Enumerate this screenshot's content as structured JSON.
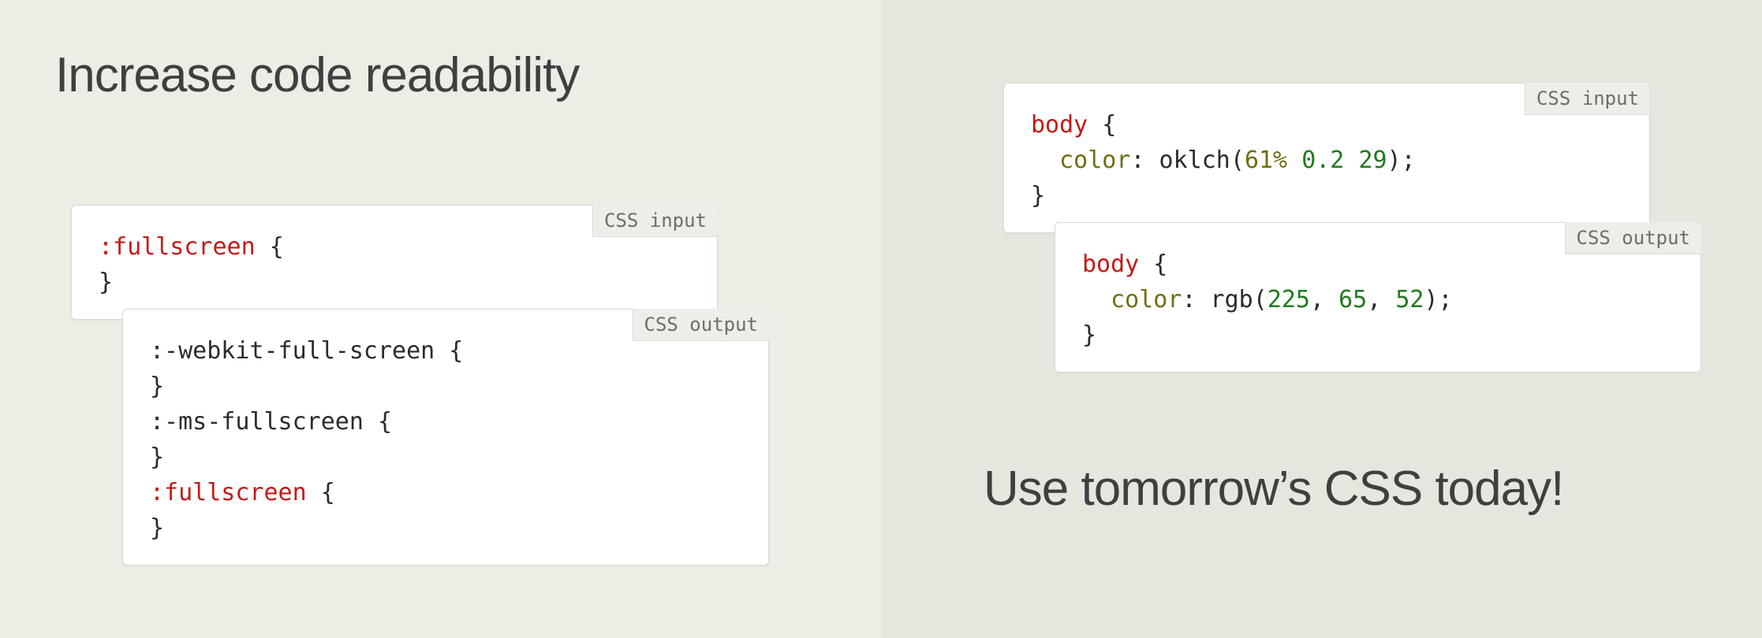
{
  "left": {
    "heading": "Increase code readability",
    "input": {
      "badge": "CSS input",
      "lines": [
        {
          "tokens": [
            {
              "cls": "sel",
              "text": ":fullscreen"
            },
            {
              "cls": null,
              "text": " {"
            }
          ]
        },
        {
          "tokens": [
            {
              "cls": null,
              "text": "}"
            }
          ]
        }
      ]
    },
    "output": {
      "badge": "CSS output",
      "lines": [
        {
          "tokens": [
            {
              "cls": null,
              "text": ":-webkit-full-screen {"
            }
          ]
        },
        {
          "tokens": [
            {
              "cls": null,
              "text": "}"
            }
          ]
        },
        {
          "tokens": [
            {
              "cls": null,
              "text": ":-ms-fullscreen {"
            }
          ]
        },
        {
          "tokens": [
            {
              "cls": null,
              "text": "}"
            }
          ]
        },
        {
          "tokens": [
            {
              "cls": "sel",
              "text": ":fullscreen"
            },
            {
              "cls": null,
              "text": " {"
            }
          ]
        },
        {
          "tokens": [
            {
              "cls": null,
              "text": "}"
            }
          ]
        }
      ]
    }
  },
  "right": {
    "heading": "Use tomorrow’s CSS today!",
    "input": {
      "badge": "CSS input",
      "lines": [
        {
          "tokens": [
            {
              "cls": "sel",
              "text": "body"
            },
            {
              "cls": null,
              "text": " {"
            }
          ]
        },
        {
          "tokens": [
            {
              "cls": null,
              "text": "  "
            },
            {
              "cls": "prop",
              "text": "color"
            },
            {
              "cls": null,
              "text": ": oklch("
            },
            {
              "cls": "pct",
              "text": "61%"
            },
            {
              "cls": null,
              "text": " "
            },
            {
              "cls": "numg",
              "text": "0.2"
            },
            {
              "cls": null,
              "text": " "
            },
            {
              "cls": "numg",
              "text": "29"
            },
            {
              "cls": null,
              "text": ");"
            }
          ]
        },
        {
          "tokens": [
            {
              "cls": null,
              "text": "}"
            }
          ]
        }
      ]
    },
    "output": {
      "badge": "CSS output",
      "lines": [
        {
          "tokens": [
            {
              "cls": "sel",
              "text": "body"
            },
            {
              "cls": null,
              "text": " {"
            }
          ]
        },
        {
          "tokens": [
            {
              "cls": null,
              "text": "  "
            },
            {
              "cls": "prop",
              "text": "color"
            },
            {
              "cls": null,
              "text": ": rgb("
            },
            {
              "cls": "numg",
              "text": "225"
            },
            {
              "cls": null,
              "text": ", "
            },
            {
              "cls": "numg",
              "text": "65"
            },
            {
              "cls": null,
              "text": ", "
            },
            {
              "cls": "numg",
              "text": "52"
            },
            {
              "cls": null,
              "text": ");"
            }
          ]
        },
        {
          "tokens": [
            {
              "cls": null,
              "text": "}"
            }
          ]
        }
      ]
    }
  }
}
